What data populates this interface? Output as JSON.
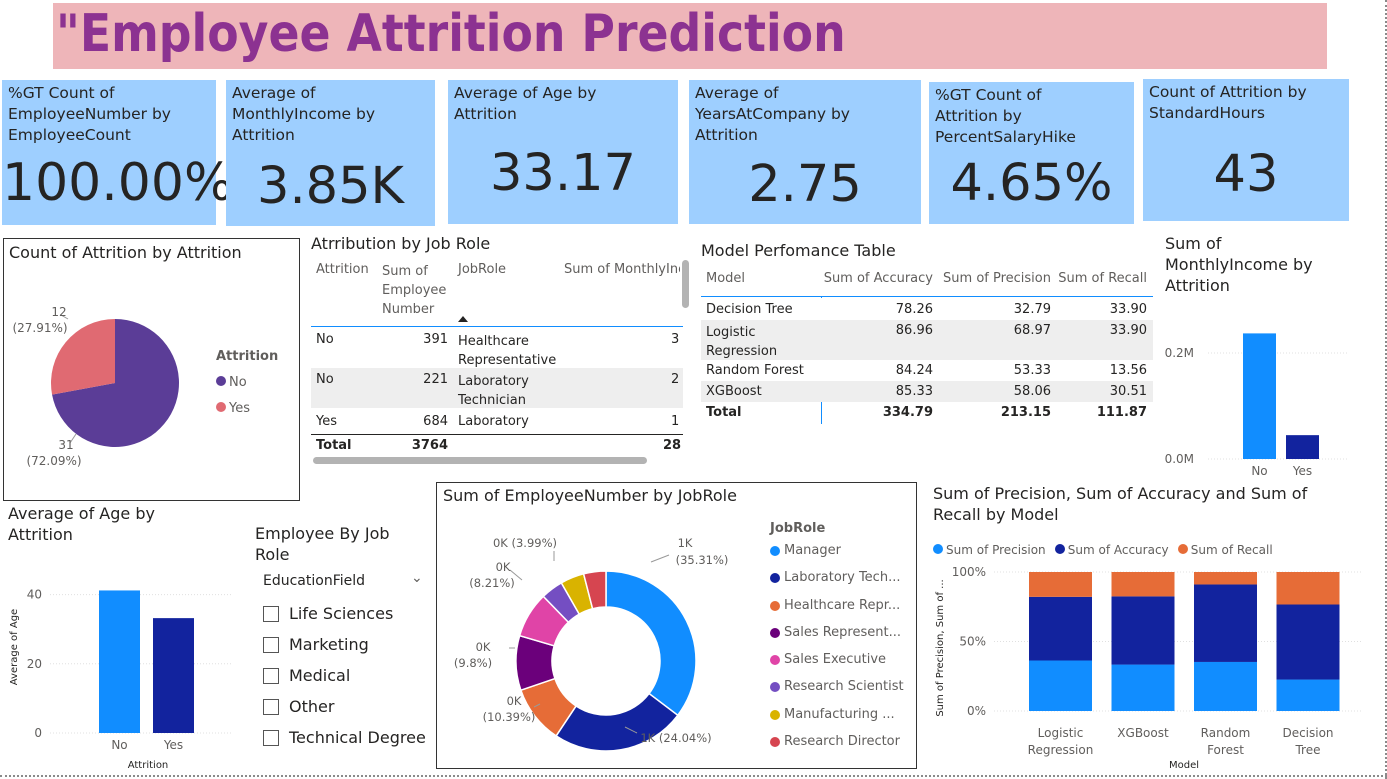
{
  "header": {
    "title": "\"Employee Attrition Prediction"
  },
  "kpis": [
    {
      "label": "%GT Count of EmployeeNumber by EmployeeCount",
      "value": "100.00%"
    },
    {
      "label": "Average of MonthlyIncome by Attrition",
      "value": "3.85K"
    },
    {
      "label": "Average of Age by Attrition",
      "value": "33.17"
    },
    {
      "label": "Average of YearsAtCompany by Attrition",
      "value": "2.75"
    },
    {
      "label": "%GT Count of Attrition by PercentSalaryHike",
      "value": "4.65%"
    },
    {
      "label": "Count of Attrition by StandardHours",
      "value": "43"
    }
  ],
  "pie": {
    "title": "Count of Attrition by Attrition",
    "legend_title": "Attrition",
    "slices": [
      {
        "name": "No",
        "count": "31",
        "pct": "(72.09%)",
        "value": 72.09,
        "color": "#5b3d97"
      },
      {
        "name": "Yes",
        "count": "12",
        "pct": "(27.91%)",
        "value": 27.91,
        "color": "#e06a72"
      }
    ]
  },
  "jobrole_table": {
    "title": "Atrribution by Job Role",
    "columns": [
      "Attrition",
      "Sum of Employee Number",
      "JobRole",
      "Sum of MonthlyInc"
    ],
    "rows": [
      {
        "attrition": "No",
        "sum": "391",
        "role": "Healthcare Representative",
        "inc": "3"
      },
      {
        "attrition": "No",
        "sum": "221",
        "role": "Laboratory Technician",
        "inc": "2"
      },
      {
        "attrition": "Yes",
        "sum": "684",
        "role": "Laboratory",
        "inc": "1"
      }
    ],
    "total": {
      "label": "Total",
      "sum": "3764",
      "inc": "28"
    }
  },
  "model_table": {
    "title": "Model Perfomance Table",
    "columns": [
      "Model",
      "Sum of Accuracy",
      "Sum of Precision",
      "Sum of Recall"
    ],
    "rows": [
      {
        "model": "Decision Tree",
        "acc": "78.26",
        "prec": "32.79",
        "rec": "33.90"
      },
      {
        "model": "Logistic Regression",
        "acc": "86.96",
        "prec": "68.97",
        "rec": "33.90"
      },
      {
        "model": "Random Forest",
        "acc": "84.24",
        "prec": "53.33",
        "rec": "13.56"
      },
      {
        "model": "XGBoost",
        "acc": "85.33",
        "prec": "58.06",
        "rec": "30.51"
      }
    ],
    "total": {
      "label": "Total",
      "acc": "334.79",
      "prec": "213.15",
      "rec": "111.87"
    }
  },
  "income_chart": {
    "title": "Sum of MonthlyIncome by Attrition",
    "yticks": [
      "0.2M",
      "0.0M"
    ],
    "ytick_values": [
      0.2,
      0.0
    ],
    "ymax": 0.3,
    "categories": [
      "No",
      "Yes"
    ],
    "values": [
      0.237,
      0.045
    ],
    "colors": [
      "#118dff",
      "#12239e"
    ]
  },
  "age_chart": {
    "title": "Average of Age by Attrition",
    "ylabel": "Average of Age",
    "xlabel": "Attrition",
    "yticks": [
      "40",
      "20",
      "0"
    ],
    "ytick_values": [
      40,
      20,
      0
    ],
    "ymax": 50,
    "categories": [
      "No",
      "Yes"
    ],
    "values": [
      41.2,
      33.2
    ],
    "colors": [
      "#118dff",
      "#12239e"
    ]
  },
  "slicer": {
    "title": "Employee By Job Role",
    "field": "EducationField",
    "items": [
      "Life Sciences",
      "Marketing",
      "Medical",
      "Other",
      "Technical Degree"
    ]
  },
  "donut": {
    "title": "Sum of EmployeeNumber by JobRole",
    "legend_title": "JobRole",
    "slices": [
      {
        "name": "Manager",
        "label": "1K",
        "pct": "(35.31%)",
        "value": 35.31,
        "color": "#118dff"
      },
      {
        "name": "Laboratory Tech...",
        "label": "1K (24.04%)",
        "pct": "",
        "value": 24.04,
        "color": "#12239e"
      },
      {
        "name": "Healthcare Repr...",
        "label": "0K",
        "pct": "(10.39%)",
        "value": 10.39,
        "color": "#e66c37"
      },
      {
        "name": "Sales Represent...",
        "label": "0K",
        "pct": "(9.8%)",
        "value": 9.8,
        "color": "#6b007b"
      },
      {
        "name": "Sales Executive",
        "label": "0K",
        "pct": "(8.21%)",
        "value": 8.21,
        "color": "#e044a7"
      },
      {
        "name": "Research Scientist",
        "label": "0K (3.99%)",
        "pct": "",
        "value": 3.99,
        "color": "#744ec2"
      },
      {
        "name": "Manufacturing ...",
        "label": "",
        "pct": "",
        "value": 4.26,
        "color": "#d9b300"
      },
      {
        "name": "Research Director",
        "label": "",
        "pct": "",
        "value": 4.0,
        "color": "#d64550"
      }
    ]
  },
  "stacked": {
    "title": "Sum of Precision, Sum of Accuracy and Sum of Recall by Model",
    "ylabel": "Sum of Precision, Sum of ...",
    "xlabel": "Model",
    "yticks": [
      "100%",
      "50%",
      "0%"
    ],
    "series": [
      {
        "name": "Sum of Precision",
        "color": "#118dff"
      },
      {
        "name": "Sum of Accuracy",
        "color": "#12239e"
      },
      {
        "name": "Sum of Recall",
        "color": "#e66c37"
      }
    ],
    "models": [
      {
        "name": "Logistic Regression",
        "line1": "Logistic",
        "line2": "Regression",
        "precision": 68.97,
        "accuracy": 86.96,
        "recall": 33.9
      },
      {
        "name": "XGBoost",
        "line1": "XGBoost",
        "line2": "",
        "precision": 58.06,
        "accuracy": 85.33,
        "recall": 30.51
      },
      {
        "name": "Random Forest",
        "line1": "Random",
        "line2": "Forest",
        "precision": 53.33,
        "accuracy": 84.24,
        "recall": 13.56
      },
      {
        "name": "Decision Tree",
        "line1": "Decision",
        "line2": "Tree",
        "precision": 32.79,
        "accuracy": 78.26,
        "recall": 33.9
      }
    ]
  }
}
